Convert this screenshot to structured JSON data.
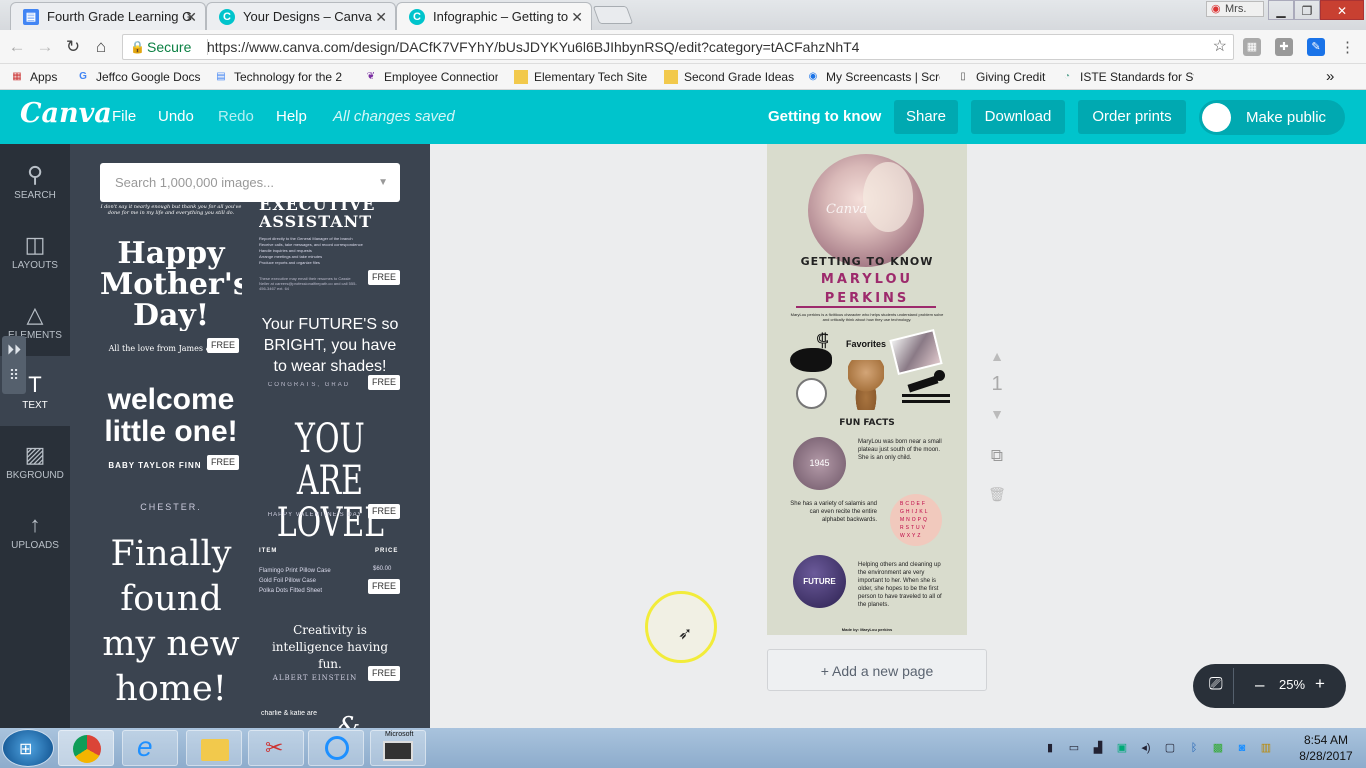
{
  "browser": {
    "tabs": [
      {
        "title": "Fourth Grade Learning G",
        "icon": "doc-icon",
        "color": "#4285f4"
      },
      {
        "title": "Your Designs – Canva",
        "icon": "canva-icon",
        "color": "#00c4cc"
      },
      {
        "title": "Infographic – Getting to",
        "icon": "canva-icon",
        "color": "#00c4cc"
      }
    ],
    "close_glyph": "✕",
    "profile": "Mrs.",
    "secure_label": "Secure",
    "url": "https://www.canva.com/design/DACfK7VFYhY/bUsJDYKYu6l6BJIhbynRSQ/edit?category=tACFahzNhT4",
    "bookmarks": [
      "Apps",
      "Jeffco Google Docs",
      "Technology for the 2",
      "Employee Connection",
      "Elementary Tech Site",
      "Second Grade Ideas",
      "My Screencasts | Scre",
      "Giving Credit",
      "ISTE Standards for St"
    ],
    "more_glyph": "»"
  },
  "canva": {
    "logo": "Canva",
    "menu": [
      "File",
      "Undo",
      "Redo",
      "Help"
    ],
    "saved_status": "All changes saved",
    "design_name": "Getting to know",
    "buttons": {
      "share": "Share",
      "download": "Download",
      "order": "Order prints",
      "public": "Make public"
    }
  },
  "rail": [
    {
      "label": "SEARCH",
      "icon": "search-icon"
    },
    {
      "label": "LAYOUTS",
      "icon": "layouts-icon"
    },
    {
      "label": "ELEMENTS",
      "icon": "elements-icon"
    },
    {
      "label": "TEXT",
      "icon": "text-icon"
    },
    {
      "label": "BKGROUND",
      "icon": "background-icon"
    },
    {
      "label": "UPLOADS",
      "icon": "uploads-icon"
    }
  ],
  "panel": {
    "search_placeholder": "Search 1,000,000 images...",
    "free": "FREE",
    "t1_top": "I don't say it nearly enough but thank you for all you've done for me in my life and everything you still do.",
    "t1_main": "Happy Mother's Day!",
    "t1_sub": "All the love from James & Julia",
    "t2_head": "EXECUTIVE ASSISTANT",
    "t2_lines": [
      "Report directly to the General Manager of the branch",
      "Receive calls, take messages, and record correspondence",
      "Handle inquiries and requests",
      "Arrange meetings and take minutes",
      "Produce reports and organize files"
    ],
    "t2_foot": "These executive may email their resumes to Cassie Neller at careers@professionalfirepath.co and call 555-456-3467 ext. 64",
    "t3_main": "Your FUTURE'S so BRIGHT, you have to wear shades!",
    "t3_sub": "CONGRATS, GRAD",
    "t4_main": "welcome little one!",
    "t4_sub": "BABY TAYLOR FINN",
    "t4_foot": "CHESTER.",
    "t5_main": "YOU ARE LOVELY",
    "t5_sub": "HAPPY VALENTINE'S DAY",
    "t6_item": "ITEM",
    "t6_price": "PRICE",
    "t6_rows": [
      "Flamingo Print Pillow Case",
      "Gold Foil Pillow Case",
      "Polka Dots Fitted Sheet"
    ],
    "t6_val": "$60.00",
    "t7_main": "Finally found my new home!",
    "t8_main": "Creativity is intelligence having fun.",
    "t8_sub": "ALBERT EINSTEIN",
    "t9_main": "charlie & katie are"
  },
  "design": {
    "heading": "GETTING TO KNOW",
    "name1": "MARYLOU",
    "name2": "PERKINS",
    "intro": "MaryLou perkins is a fictitious character who helps students understand problem solve and critically think about how they use technology.",
    "favorites": "Favorites",
    "fun_facts": "FUN FACTS",
    "fact1_badge": "1945",
    "fact1": "MaryLou was born near a small plateau just south of the moon. She is an only child.",
    "fact2": "She has a variety of salamis and can even recite the entire alphabet backwards.",
    "fact3_badge": "FUTURE",
    "fact3": "Helping others and cleaning up the environment are very important to her. When she is older, she hopes to be the first person to have traveled to all of the planets.",
    "credit": "Made by: MaryLou perkins",
    "watermark": "Canva"
  },
  "page_number": "1",
  "add_page": "+ Add a new page",
  "zoom": {
    "level": "25%",
    "minus": "–",
    "plus": "+"
  },
  "taskbar": {
    "time": "8:54 AM",
    "date": "8/28/2017",
    "snip_label": "Microsoft"
  }
}
